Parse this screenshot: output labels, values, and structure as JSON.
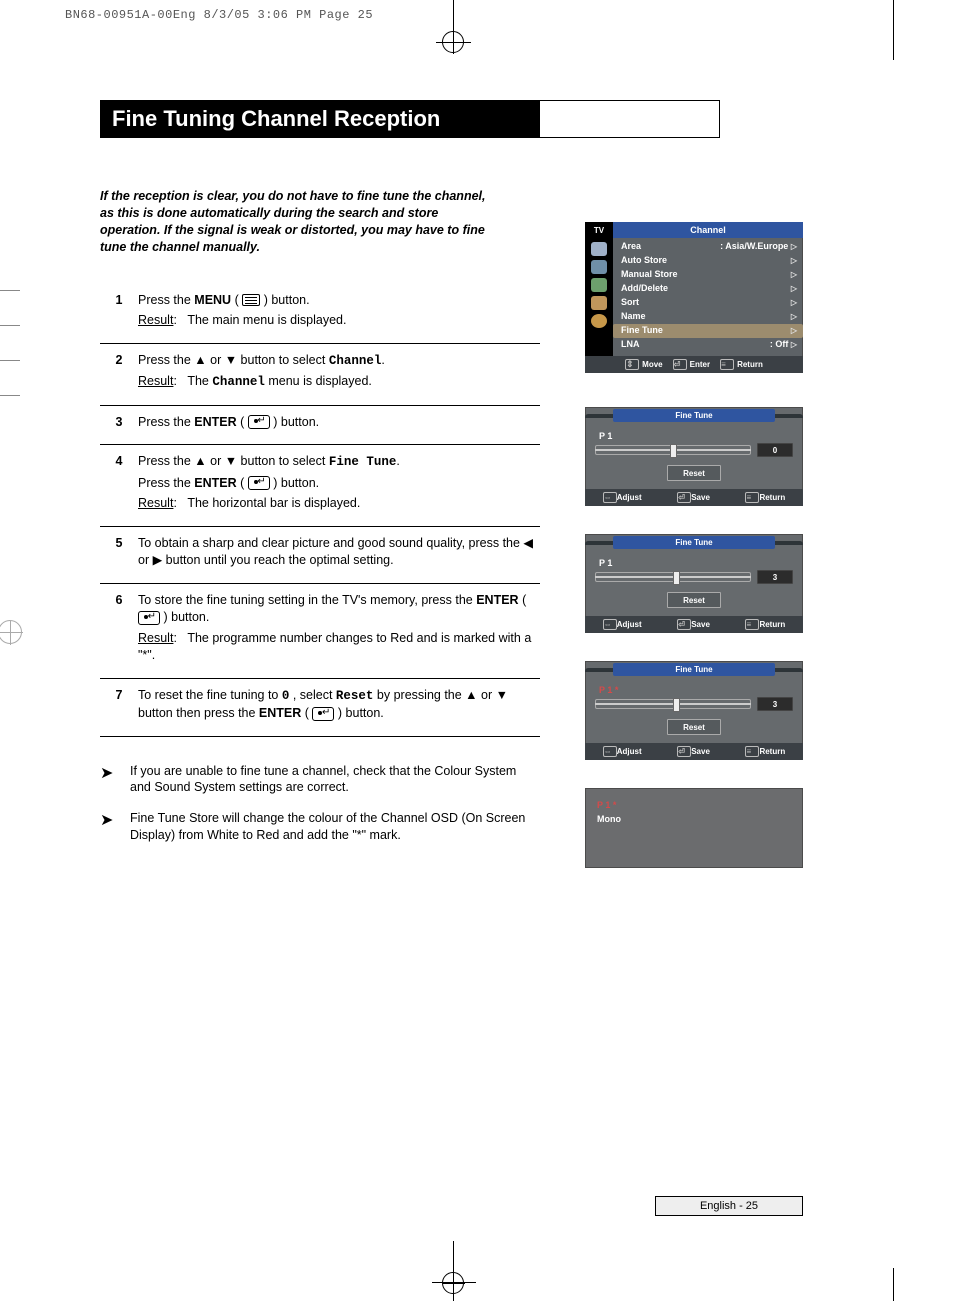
{
  "runhead": "BN68-00951A-00Eng  8/3/05  3:06 PM  Page 25",
  "title": "Fine Tuning Channel Reception",
  "intro": "If the reception is clear, you do not have to fine tune the channel, as this is done automatically during the search and store operation. If the signal is weak or distorted, you may have to fine tune the channel manually.",
  "steps": {
    "s1": {
      "num": "1",
      "p1_a": "Press the ",
      "p1_menu": "MENU",
      "p1_b": " ( ",
      "p1_c": " ) button.",
      "res_label": "Result",
      "res_text": "The main menu is displayed."
    },
    "s2": {
      "num": "2",
      "p1": "Press the ▲ or ▼ button to select ",
      "p1_mono": "Channel",
      "p1_end": ".",
      "res_label": "Result",
      "res_a": "The ",
      "res_mono": "Channel",
      "res_b": " menu is displayed."
    },
    "s3": {
      "num": "3",
      "p1_a": "Press the ",
      "p1_enter": "ENTER",
      "p1_b": " ( ",
      "p1_c": " ) button."
    },
    "s4": {
      "num": "4",
      "p1": "Press the ▲ or ▼ button to select ",
      "p1_mono": "Fine Tune",
      "p1_end": ".",
      "p2_a": "Press the ",
      "p2_enter": "ENTER",
      "p2_b": " ( ",
      "p2_c": " ) button.",
      "res_label": "Result",
      "res_text": "The horizontal bar is displayed."
    },
    "s5": {
      "num": "5",
      "p1": "To obtain a sharp and clear picture and good sound quality, press the ◀ or ▶ button until you reach the optimal setting."
    },
    "s6": {
      "num": "6",
      "p1_a": "To store the fine tuning setting in the TV's memory, press the ",
      "p1_enter": "ENTER",
      "p1_b": " ( ",
      "p1_c": " ) button.",
      "res_label": "Result",
      "res_text": "The programme number changes to Red and is marked with a \"*\"."
    },
    "s7": {
      "num": "7",
      "p1_a": "To reset the fine tuning to ",
      "p1_zero": "0",
      "p1_b": ", select ",
      "p1_reset": "Reset",
      "p1_c": " by pressing the ▲ or ▼ button then press the ",
      "p1_enter": "ENTER",
      "p1_d": " ( ",
      "p1_e": " ) button."
    }
  },
  "notes": {
    "n1": "If you are unable to fine tune a channel, check that the Colour System and Sound System settings are correct.",
    "n2": "Fine Tune Store will change the colour of the Channel OSD (On Screen Display) from White to Red and add the \"*\" mark."
  },
  "osd": {
    "tv": "TV",
    "title": "Channel",
    "rows": [
      {
        "label": "Area",
        "value": ": Asia/W.Europe"
      },
      {
        "label": "Auto Store",
        "value": ""
      },
      {
        "label": "Manual Store",
        "value": ""
      },
      {
        "label": "Add/Delete",
        "value": ""
      },
      {
        "label": "Sort",
        "value": ""
      },
      {
        "label": "Name",
        "value": ""
      },
      {
        "label": "Fine Tune",
        "value": ""
      },
      {
        "label": "LNA",
        "value": ": Off"
      }
    ],
    "foot_move": "Move",
    "foot_enter": "Enter",
    "foot_return": "Return"
  },
  "ft": {
    "title": "Fine Tune",
    "p1": {
      "prog": "P  1",
      "value": "0",
      "knob_pct": 48
    },
    "p2": {
      "prog": "P  1",
      "value": "3",
      "knob_pct": 50
    },
    "p3": {
      "prog": "P  1 *",
      "value": "3",
      "knob_pct": 50
    },
    "reset": "Reset",
    "foot_adjust": "Adjust",
    "foot_save": "Save",
    "foot_return": "Return"
  },
  "thumb": {
    "line1": "P   1 *",
    "line2": "Mono"
  },
  "page_number": "English - 25"
}
